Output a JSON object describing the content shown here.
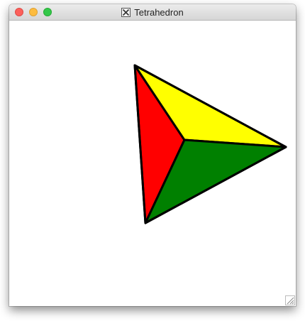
{
  "window": {
    "title": "Tetrahedron"
  },
  "icons": {
    "app_icon": "x11-icon",
    "resize": "resize-grip-icon"
  },
  "colors": {
    "face_left": "#ff0000",
    "face_top": "#ffff00",
    "face_bottom": "#008000",
    "edge": "#000000"
  }
}
